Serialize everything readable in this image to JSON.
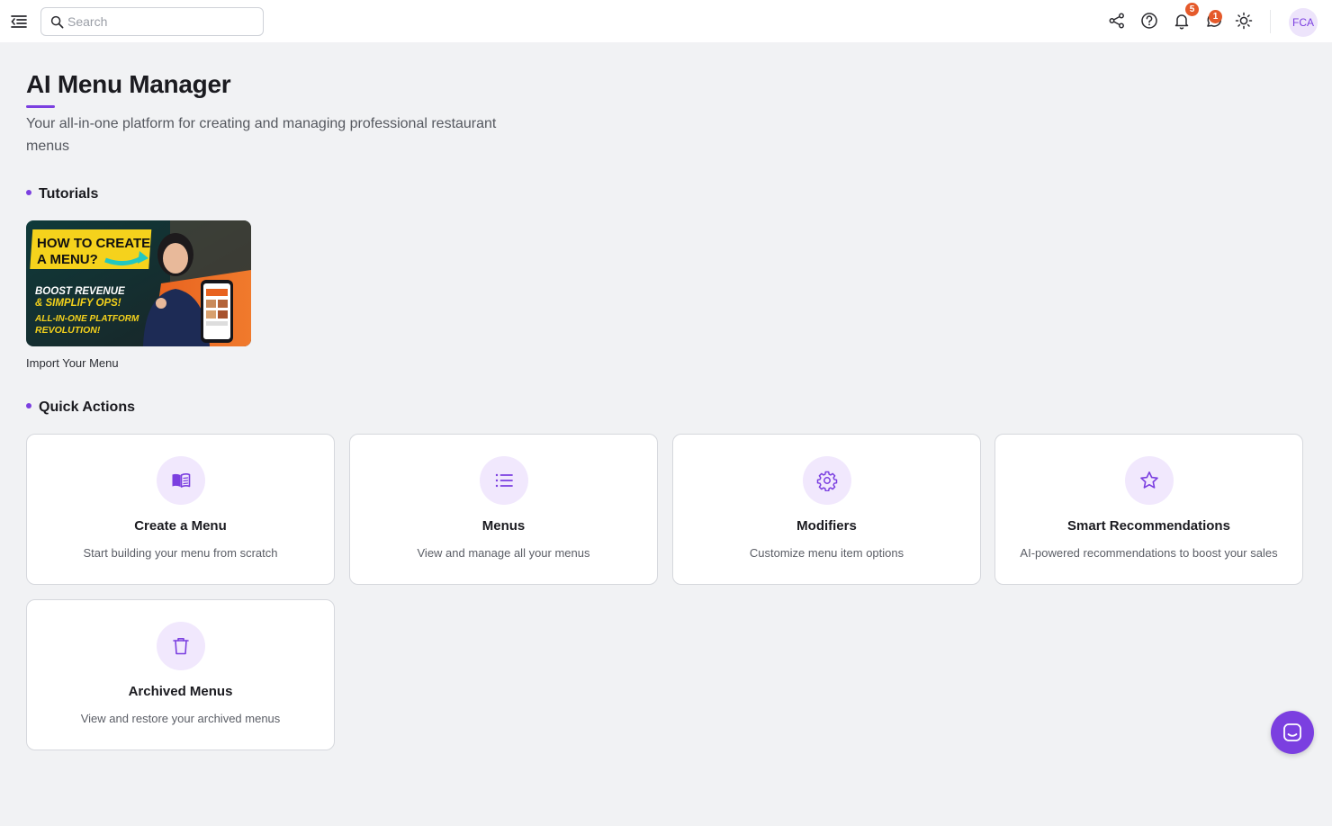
{
  "search": {
    "placeholder": "Search"
  },
  "topbar": {
    "notifications_badge": "5",
    "messages_badge": "1",
    "avatar_initials": "FCA"
  },
  "page": {
    "title": "AI Menu Manager",
    "subtitle": "Your all-in-one platform for creating and managing professional restaurant menus"
  },
  "tutorials": {
    "heading": "Tutorials",
    "items": [
      {
        "caption": "Import Your Menu",
        "thumbnail_text": {
          "line1": "HOW TO CREATE",
          "line2": "A MENU?",
          "line3": "BOOST REVENUE",
          "line4": "& SIMPLIFY OPS!",
          "line5": "ALL-IN-ONE PLATFORM",
          "line6": "REVOLUTION!"
        }
      }
    ]
  },
  "quick_actions": {
    "heading": "Quick Actions",
    "cards": [
      {
        "title": "Create a Menu",
        "description": "Start building your menu from scratch",
        "icon": "book-icon"
      },
      {
        "title": "Menus",
        "description": "View and manage all your menus",
        "icon": "list-icon"
      },
      {
        "title": "Modifiers",
        "description": "Customize menu item options",
        "icon": "gear-icon"
      },
      {
        "title": "Smart Recommendations",
        "description": "AI-powered recommendations to boost your sales",
        "icon": "star-icon"
      },
      {
        "title": "Archived Menus",
        "description": "View and restore your archived menus",
        "icon": "trash-icon"
      }
    ]
  },
  "colors": {
    "accent": "#7b3fe0",
    "accent_light": "#f1e8fd",
    "badge": "#e55a2b",
    "background": "#f1f2f4"
  }
}
